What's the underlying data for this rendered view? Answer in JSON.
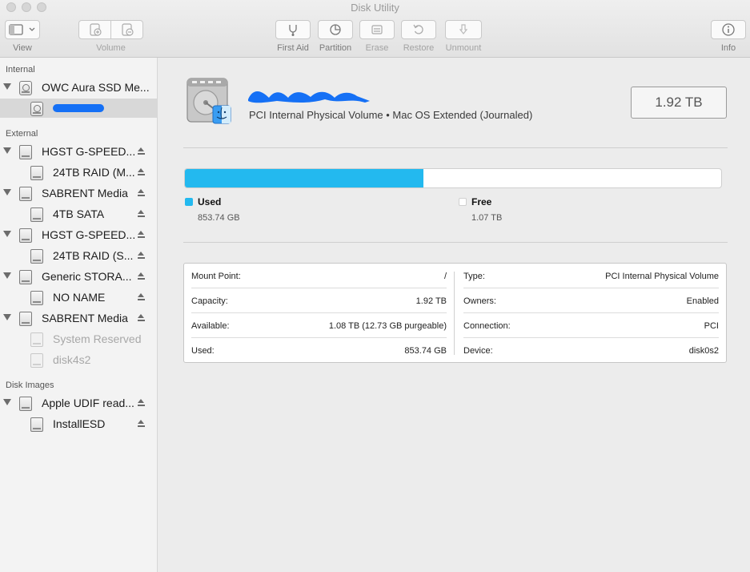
{
  "window": {
    "title": "Disk Utility"
  },
  "toolbar": {
    "view_label": "View",
    "volume_label": "Volume",
    "first_aid_label": "First Aid",
    "partition_label": "Partition",
    "erase_label": "Erase",
    "restore_label": "Restore",
    "unmount_label": "Unmount",
    "info_label": "Info"
  },
  "sidebar": {
    "internal_header": "Internal",
    "external_header": "External",
    "disk_images_header": "Disk Images",
    "internal_items": [
      {
        "label": "OWC Aura SSD Me...",
        "expanded": true,
        "icon": "internal-disk-icon"
      },
      {
        "label": "",
        "selected": true,
        "icon": "internal-volume-icon",
        "redacted": true
      }
    ],
    "external_items": [
      {
        "label": "HGST G-SPEED...",
        "eject": true
      },
      {
        "label": "24TB RAID (M...",
        "eject": true
      },
      {
        "label": "SABRENT Media",
        "eject": true
      },
      {
        "label": "4TB SATA",
        "eject": true
      },
      {
        "label": "HGST G-SPEED...",
        "eject": true
      },
      {
        "label": "24TB RAID (S...",
        "eject": true
      },
      {
        "label": "Generic STORA...",
        "eject": true
      },
      {
        "label": "NO NAME",
        "eject": true
      },
      {
        "label": "SABRENT Media",
        "eject": true
      },
      {
        "label": "System Reserved",
        "eject": false,
        "dim": true
      },
      {
        "label": "disk4s2",
        "eject": false,
        "dim": true
      }
    ],
    "disk_image_items": [
      {
        "label": "Apple UDIF read...",
        "eject": true
      },
      {
        "label": "InstallESD",
        "eject": true
      }
    ]
  },
  "volume": {
    "name_redacted": true,
    "subtitle": "PCI Internal Physical Volume • Mac OS Extended (Journaled)",
    "capacity": "1.92 TB"
  },
  "usage": {
    "used_fraction": 0.4448,
    "used_label": "Used",
    "used_value": "853.74 GB",
    "free_label": "Free",
    "free_value": "1.07 TB",
    "used_color": "#23b9ef",
    "free_color": "#ffffff"
  },
  "info": {
    "left": [
      {
        "key": "Mount Point:",
        "value": "/"
      },
      {
        "key": "Capacity:",
        "value": "1.92 TB"
      },
      {
        "key": "Available:",
        "value": "1.08 TB (12.73 GB purgeable)"
      },
      {
        "key": "Used:",
        "value": "853.74 GB"
      }
    ],
    "right": [
      {
        "key": "Type:",
        "value": "PCI Internal Physical Volume"
      },
      {
        "key": "Owners:",
        "value": "Enabled"
      },
      {
        "key": "Connection:",
        "value": "PCI"
      },
      {
        "key": "Device:",
        "value": "disk0s2"
      }
    ]
  }
}
